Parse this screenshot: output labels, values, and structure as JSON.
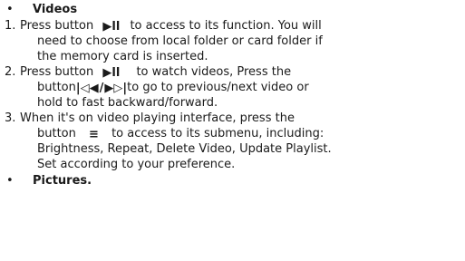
{
  "section_videos": {
    "bullet": "•",
    "title": "Videos"
  },
  "step1": {
    "num": "1.",
    "a": "Press button",
    "b": "to access to its function. You will",
    "line2": "need to choose from local folder or card folder if",
    "line3": "the memory card is inserted."
  },
  "step2": {
    "num": "2.",
    "a": "Press button",
    "b": "to watch videos, Press the",
    "c": "button",
    "d": "to go to previous/next video or",
    "line3": "hold to fast backward/forward."
  },
  "step3": {
    "num": "3.",
    "line1": "When it's on video playing interface, press the",
    "a": "button",
    "b": "to access to its submenu, including:",
    "line3": "Brightness, Repeat, Delete Video, Update Playlist.",
    "line4": "Set according to your preference."
  },
  "section_pictures": {
    "bullet": "•",
    "title": "Pictures."
  },
  "icons": {
    "play_pause": "▶ll",
    "prev": "|◁◀",
    "separator": "/",
    "next": "▶▷|",
    "menu": "≡"
  }
}
